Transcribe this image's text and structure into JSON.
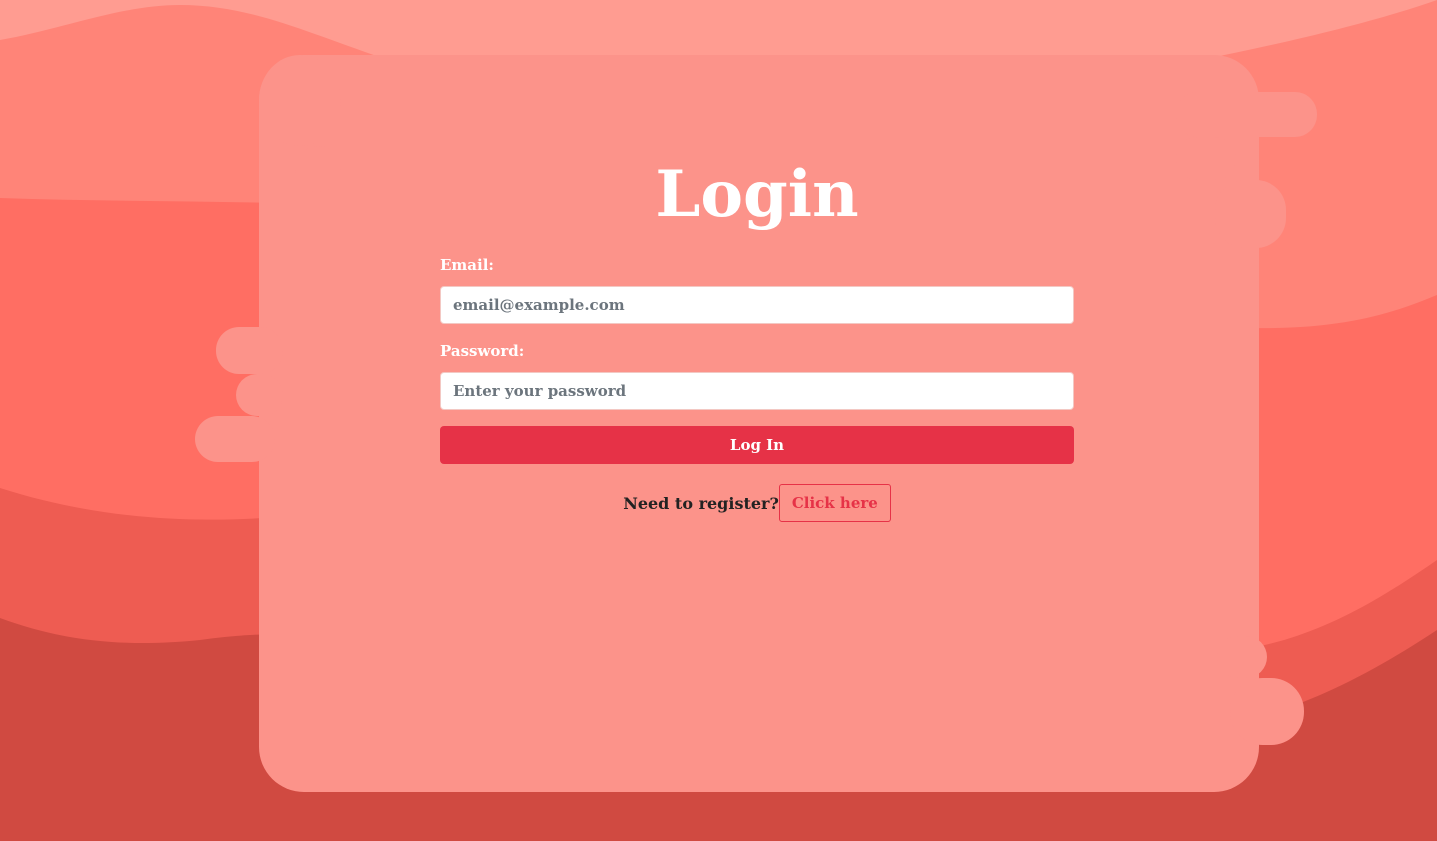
{
  "login": {
    "title": "Login",
    "email_label": "Email:",
    "email_placeholder": "email@example.com",
    "email_value": "",
    "password_label": "Password:",
    "password_placeholder": "Enter your password",
    "password_value": "",
    "submit_label": "Log In",
    "register_prompt": "Need to register?",
    "register_link": "Click here"
  },
  "colors": {
    "background_top": "#ff9c91",
    "wave_light": "#ff8478",
    "wave_mid": "#ff6e63",
    "wave_deep": "#ee5c52",
    "wave_base": "#d04a41",
    "card": "#fc938a",
    "accent": "#e63247",
    "text_dark": "#222222",
    "placeholder": "#6c757d"
  }
}
